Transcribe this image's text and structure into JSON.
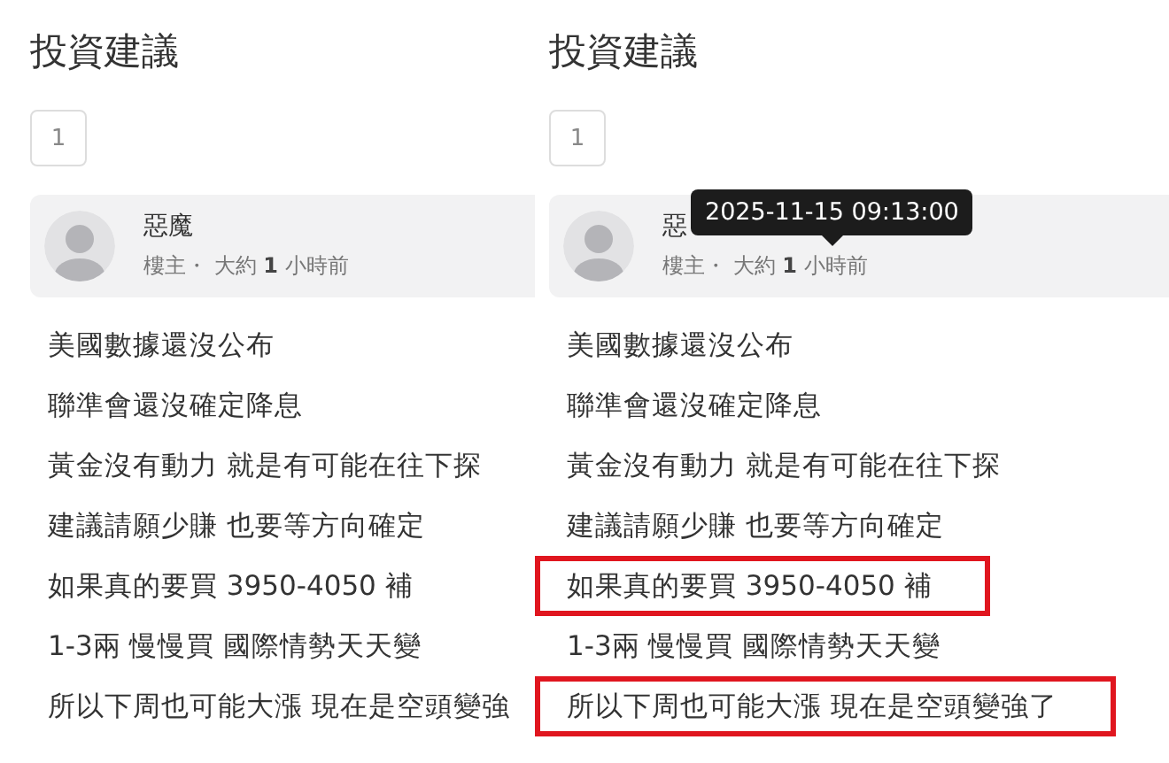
{
  "panels": [
    {
      "title": "投資建議",
      "page": "1",
      "post": {
        "author": "惡魔",
        "meta": "樓主・ 大約 **1** 小時前"
      },
      "lines": [
        {
          "text": "美國數據還沒公布",
          "highlighted": false
        },
        {
          "text": "聯準會還沒確定降息",
          "highlighted": false
        },
        {
          "text": "黃金沒有動力 就是有可能在往下探",
          "highlighted": false
        },
        {
          "text": "建議請願少賺 也要等方向確定",
          "highlighted": false
        },
        {
          "text": "如果真的要買 3950-4050 補",
          "highlighted": false
        },
        {
          "text": "1-3兩 慢慢買 國際情勢天天變",
          "highlighted": false
        },
        {
          "text": "所以下周也可能大漲 現在是空頭變強",
          "highlighted": false
        }
      ]
    },
    {
      "title": "投資建議",
      "page": "1",
      "post": {
        "author": "惡",
        "meta": "樓主・ 大約 **1** 小時前",
        "tooltip": "2025-11-15 09:13:00"
      },
      "lines": [
        {
          "text": "美國數據還沒公布",
          "highlighted": false
        },
        {
          "text": "聯準會還沒確定降息",
          "highlighted": false
        },
        {
          "text": "黃金沒有動力 就是有可能在往下探",
          "highlighted": false
        },
        {
          "text": "建議請願少賺 也要等方向確定",
          "highlighted": false
        },
        {
          "text": "如果真的要買 3950-4050 補",
          "highlighted": true
        },
        {
          "text": "1-3兩 慢慢買 國際情勢天天變",
          "highlighted": false
        },
        {
          "text": "所以下周也可能大漲 現在是空頭變強了",
          "highlighted": true
        }
      ]
    }
  ]
}
